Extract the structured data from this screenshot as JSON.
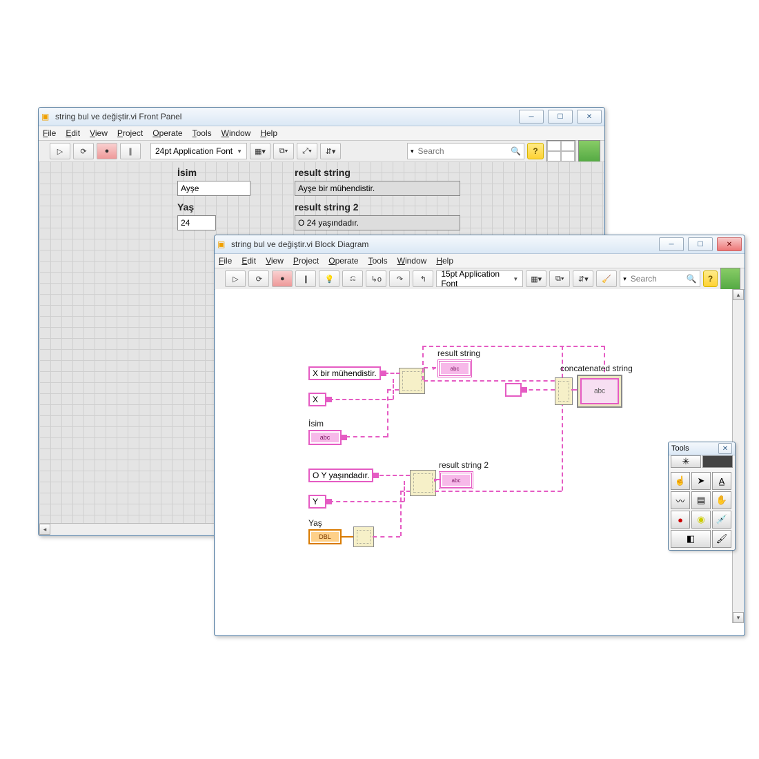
{
  "frontPanel": {
    "title": "string bul ve değiştir.vi Front Panel",
    "font": "24pt Application Font",
    "searchPlaceholder": "Search",
    "menu": [
      "File",
      "Edit",
      "View",
      "Project",
      "Operate",
      "Tools",
      "Window",
      "Help"
    ],
    "controls": [
      {
        "label": "İsim",
        "value": "Ayşe"
      },
      {
        "label": "Yaş",
        "value": "24"
      }
    ],
    "indicators": [
      {
        "label": "result string",
        "value": "Ayşe bir mühendistir."
      },
      {
        "label": "result string 2",
        "value": "O 24 yaşındadır."
      }
    ]
  },
  "blockDiagram": {
    "title": "string bul ve değiştir.vi Block Diagram",
    "font": "15pt Application Font",
    "searchPlaceholder": "Search",
    "menu": [
      "File",
      "Edit",
      "View",
      "Project",
      "Operate",
      "Tools",
      "Window",
      "Help"
    ],
    "nodes": {
      "const1": "X bir mühendistir.",
      "constX": "X",
      "isimLabel": "İsim",
      "result1Label": "result string",
      "const2": "O Y yaşındadır.",
      "constY": "Y",
      "yasLabel": "Yaş",
      "result2Label": "result string 2",
      "concatLabel": "concatenated string"
    }
  },
  "tools": {
    "title": "Tools",
    "items": [
      "auto",
      "operate",
      "position",
      "text",
      "wiring",
      "shortcut",
      "scroll",
      "breakpoint",
      "probe",
      "color-copy",
      "color-bg",
      "color-brush"
    ]
  }
}
